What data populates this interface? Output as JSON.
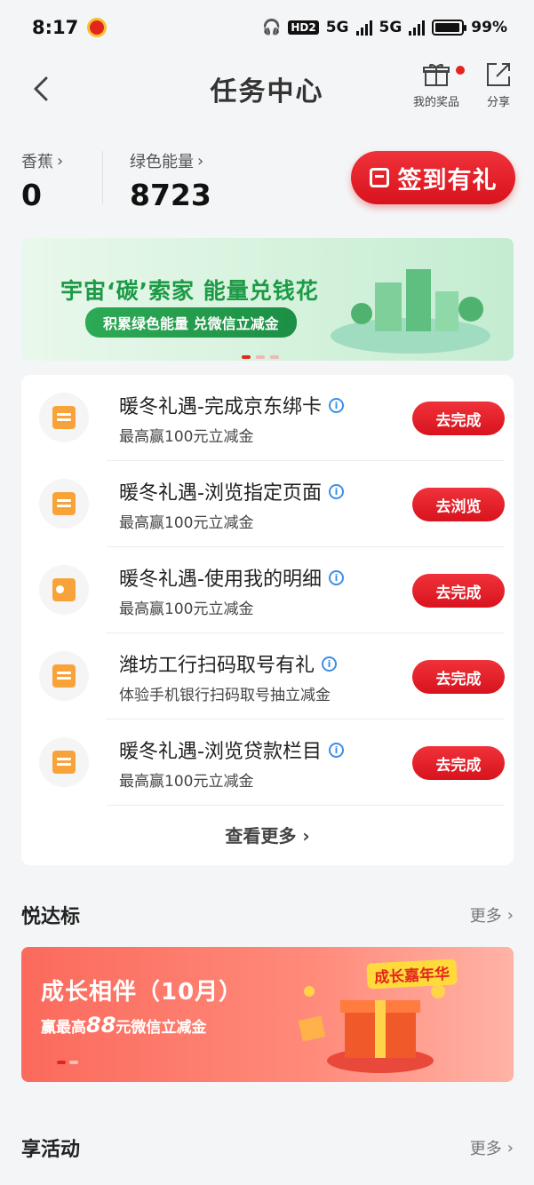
{
  "status_bar": {
    "time": "8:17",
    "network_1": "5G",
    "network_2": "5G",
    "hd": "HD2",
    "battery": "99%"
  },
  "header": {
    "title": "任务中心",
    "prizes_label": "我的奖品",
    "share_label": "分享"
  },
  "summary": {
    "bananas": {
      "label": "香蕉",
      "value": "0"
    },
    "green_energy": {
      "label": "绿色能量",
      "value": "8723"
    },
    "signin_label": "签到有礼"
  },
  "green_banner": {
    "title": "宇宙‘碳’索家 能量兑钱花",
    "subtitle": "积累绿色能量 兑微信立减金"
  },
  "tasks": [
    {
      "name": "暖冬礼遇-完成京东绑卡",
      "desc": "最高赢100元立减金",
      "action": "去完成",
      "icon": "calendar-icon"
    },
    {
      "name": "暖冬礼遇-浏览指定页面",
      "desc": "最高赢100元立减金",
      "action": "去浏览",
      "icon": "calendar-icon"
    },
    {
      "name": "暖冬礼遇-使用我的明细",
      "desc": "最高赢100元立减金",
      "action": "去完成",
      "icon": "chart-icon"
    },
    {
      "name": "潍坊工行扫码取号有礼",
      "desc": "体验手机银行扫码取号抽立减金",
      "action": "去完成",
      "icon": "calendar-icon"
    },
    {
      "name": "暖冬礼遇-浏览贷款栏目",
      "desc": "最高赢100元立减金",
      "action": "去完成",
      "icon": "calendar-icon"
    }
  ],
  "tasks_more": "查看更多",
  "section_yueda": {
    "title": "悦达标",
    "more": "更多"
  },
  "red_banner": {
    "title": "成长相伴（10月）",
    "sub_prefix": "赢最高",
    "amount": "88",
    "sub_suffix": "元微信立减金",
    "badge": "成长嘉年华"
  },
  "section_activity": {
    "title": "享活动",
    "more": "更多"
  },
  "colors": {
    "brand_red": "#e3261d",
    "green": "#1c9a45"
  }
}
